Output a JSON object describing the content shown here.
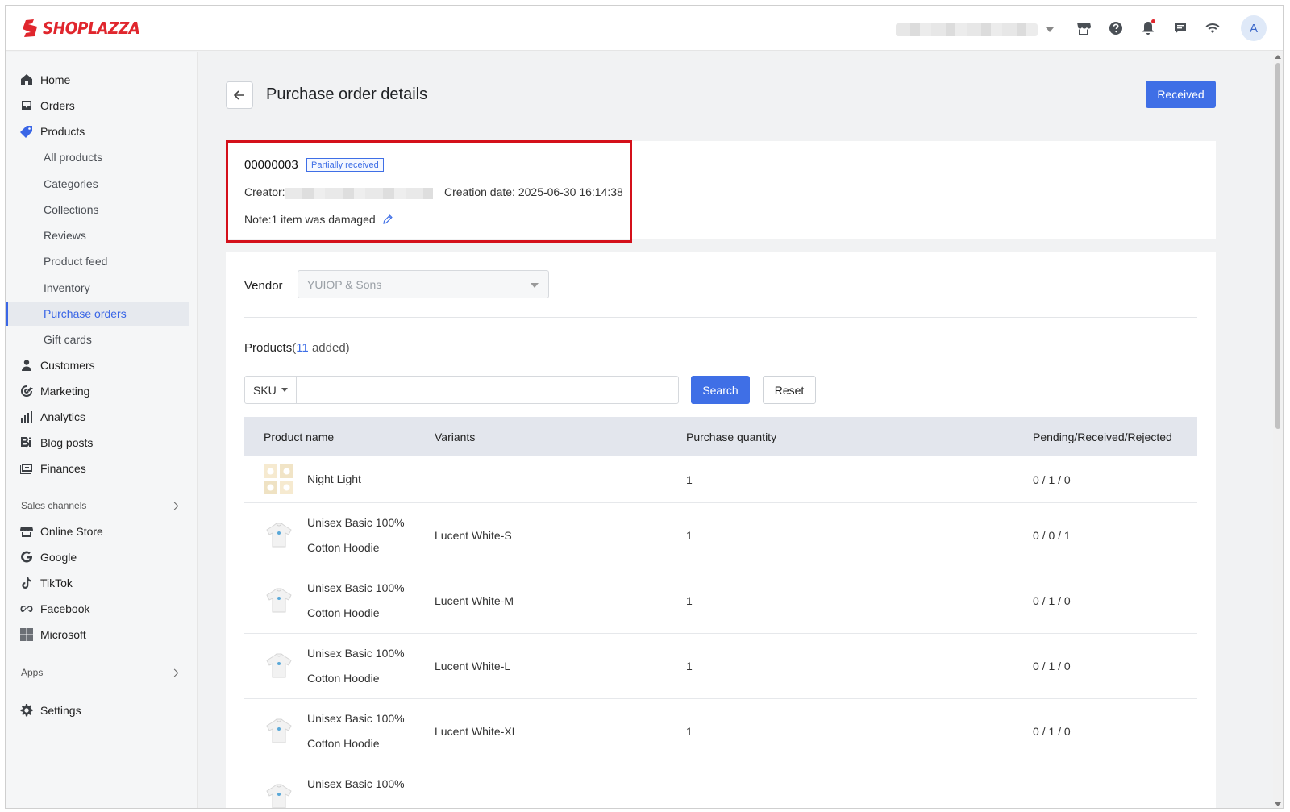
{
  "brand": {
    "name": "SHOPLAZZA",
    "color": "#e0262d"
  },
  "accent_color": "#3f6fe6",
  "topbar": {
    "icons": [
      "store-icon",
      "help-icon",
      "bell-icon",
      "chat-icon",
      "wifi-icon"
    ],
    "avatar_initial": "A"
  },
  "sidebar": {
    "items": [
      {
        "label": "Home",
        "icon": "home-icon"
      },
      {
        "label": "Orders",
        "icon": "inbox-icon"
      },
      {
        "label": "Products",
        "icon": "tag-icon"
      },
      {
        "label": "Customers",
        "icon": "person-icon"
      },
      {
        "label": "Marketing",
        "icon": "target-icon"
      },
      {
        "label": "Analytics",
        "icon": "bar-chart-icon"
      },
      {
        "label": "Blog posts",
        "icon": "blog-icon"
      },
      {
        "label": "Finances",
        "icon": "finance-icon"
      }
    ],
    "product_sub_items": [
      "All products",
      "Categories",
      "Collections",
      "Reviews",
      "Product feed",
      "Inventory",
      "Purchase orders",
      "Gift cards"
    ],
    "selected_sub_item": "Purchase orders",
    "sales_channels_label": "Sales channels",
    "channels": [
      {
        "label": "Online Store",
        "icon": "store-icon"
      },
      {
        "label": "Google",
        "icon": "google-icon"
      },
      {
        "label": "TikTok",
        "icon": "tiktok-icon"
      },
      {
        "label": "Facebook",
        "icon": "meta-icon"
      },
      {
        "label": "Microsoft",
        "icon": "microsoft-icon"
      }
    ],
    "apps_label": "Apps",
    "settings_label": "Settings"
  },
  "page": {
    "title": "Purchase order details",
    "received_button": "Received"
  },
  "order": {
    "number": "00000003",
    "status": "Partially received",
    "creator_label": "Creator:",
    "creation_date": "Creation date: 2025-06-30 16:14:38",
    "note": "Note:1 item was damaged"
  },
  "vendor": {
    "label": "Vendor",
    "value": "YUIOP & Sons"
  },
  "products": {
    "heading": "Products",
    "count": "11",
    "count_suffix": " added)",
    "count_prefix": "(",
    "search_field": "SKU",
    "search_value": "",
    "search_button": "Search",
    "reset_button": "Reset",
    "columns": [
      "Product name",
      "Variants",
      "Purchase quantity",
      "Pending/Received/Rejected"
    ],
    "rows": [
      {
        "name_line1": "Night Light",
        "name_line2": "",
        "variant": "",
        "quantity": "1",
        "status": "0 / 1 / 0",
        "thumb": "night-light"
      },
      {
        "name_line1": "Unisex Basic 100%",
        "name_line2": "Cotton Hoodie",
        "variant": "Lucent White-S",
        "quantity": "1",
        "status": "0 / 0 / 1",
        "thumb": "hoodie"
      },
      {
        "name_line1": "Unisex Basic 100%",
        "name_line2": "Cotton Hoodie",
        "variant": "Lucent White-M",
        "quantity": "1",
        "status": "0 / 1 / 0",
        "thumb": "hoodie"
      },
      {
        "name_line1": "Unisex Basic 100%",
        "name_line2": "Cotton Hoodie",
        "variant": "Lucent White-L",
        "quantity": "1",
        "status": "0 / 1 / 0",
        "thumb": "hoodie"
      },
      {
        "name_line1": "Unisex Basic 100%",
        "name_line2": "Cotton Hoodie",
        "variant": "Lucent White-XL",
        "quantity": "1",
        "status": "0 / 1 / 0",
        "thumb": "hoodie"
      },
      {
        "name_line1": "Unisex Basic 100%",
        "name_line2": "",
        "variant": "",
        "quantity": "",
        "status": "",
        "thumb": "hoodie"
      }
    ]
  }
}
